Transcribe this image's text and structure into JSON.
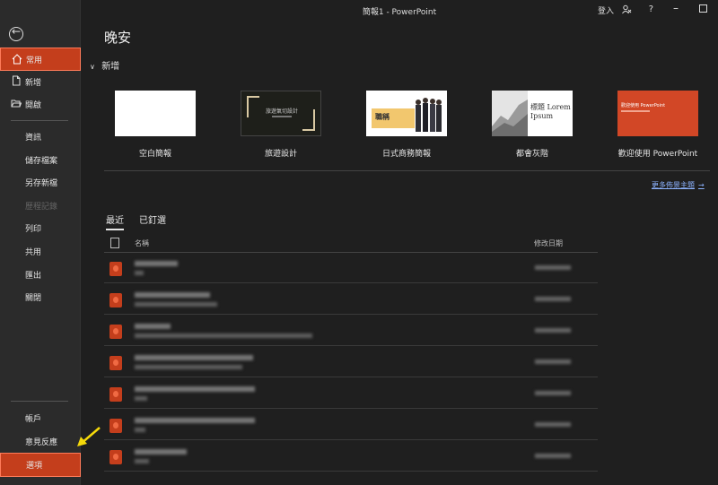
{
  "titlebar": {
    "title": "簡報1  -  PowerPoint",
    "signin": "登入",
    "help": "?"
  },
  "sidebar": {
    "items": [
      {
        "label": "常用"
      },
      {
        "label": "新增"
      },
      {
        "label": "開啟"
      },
      {
        "label": "資訊"
      },
      {
        "label": "儲存檔案"
      },
      {
        "label": "另存新檔"
      },
      {
        "label": "歷程記錄"
      },
      {
        "label": "列印"
      },
      {
        "label": "共用"
      },
      {
        "label": "匯出"
      },
      {
        "label": "關閉"
      },
      {
        "label": "帳戶"
      },
      {
        "label": "意見反應"
      },
      {
        "label": "選項"
      }
    ]
  },
  "main": {
    "greeting": "晚安",
    "new_section": "新增",
    "templates": [
      {
        "label": "空白簡報"
      },
      {
        "label": "旅遊設計",
        "thumb_text": "旅遊氣切設計"
      },
      {
        "label": "日式商務簡報",
        "thumb_text": "職稱"
      },
      {
        "label": "都會灰階",
        "thumb_text": "標題 Lorem Ipsum"
      },
      {
        "label": "歡迎使用 PowerPoint",
        "thumb_text": "歡迎使用 PowerPoint"
      }
    ],
    "more_themes": "更多佈景主題",
    "tabs": [
      {
        "label": "最近"
      },
      {
        "label": "已釘選"
      }
    ],
    "columns": {
      "name": "名稱",
      "date": "修改日期"
    },
    "colors": {
      "accent": "#c43e1c",
      "link": "#8db3ff",
      "arrow": "#f5d90a"
    }
  }
}
